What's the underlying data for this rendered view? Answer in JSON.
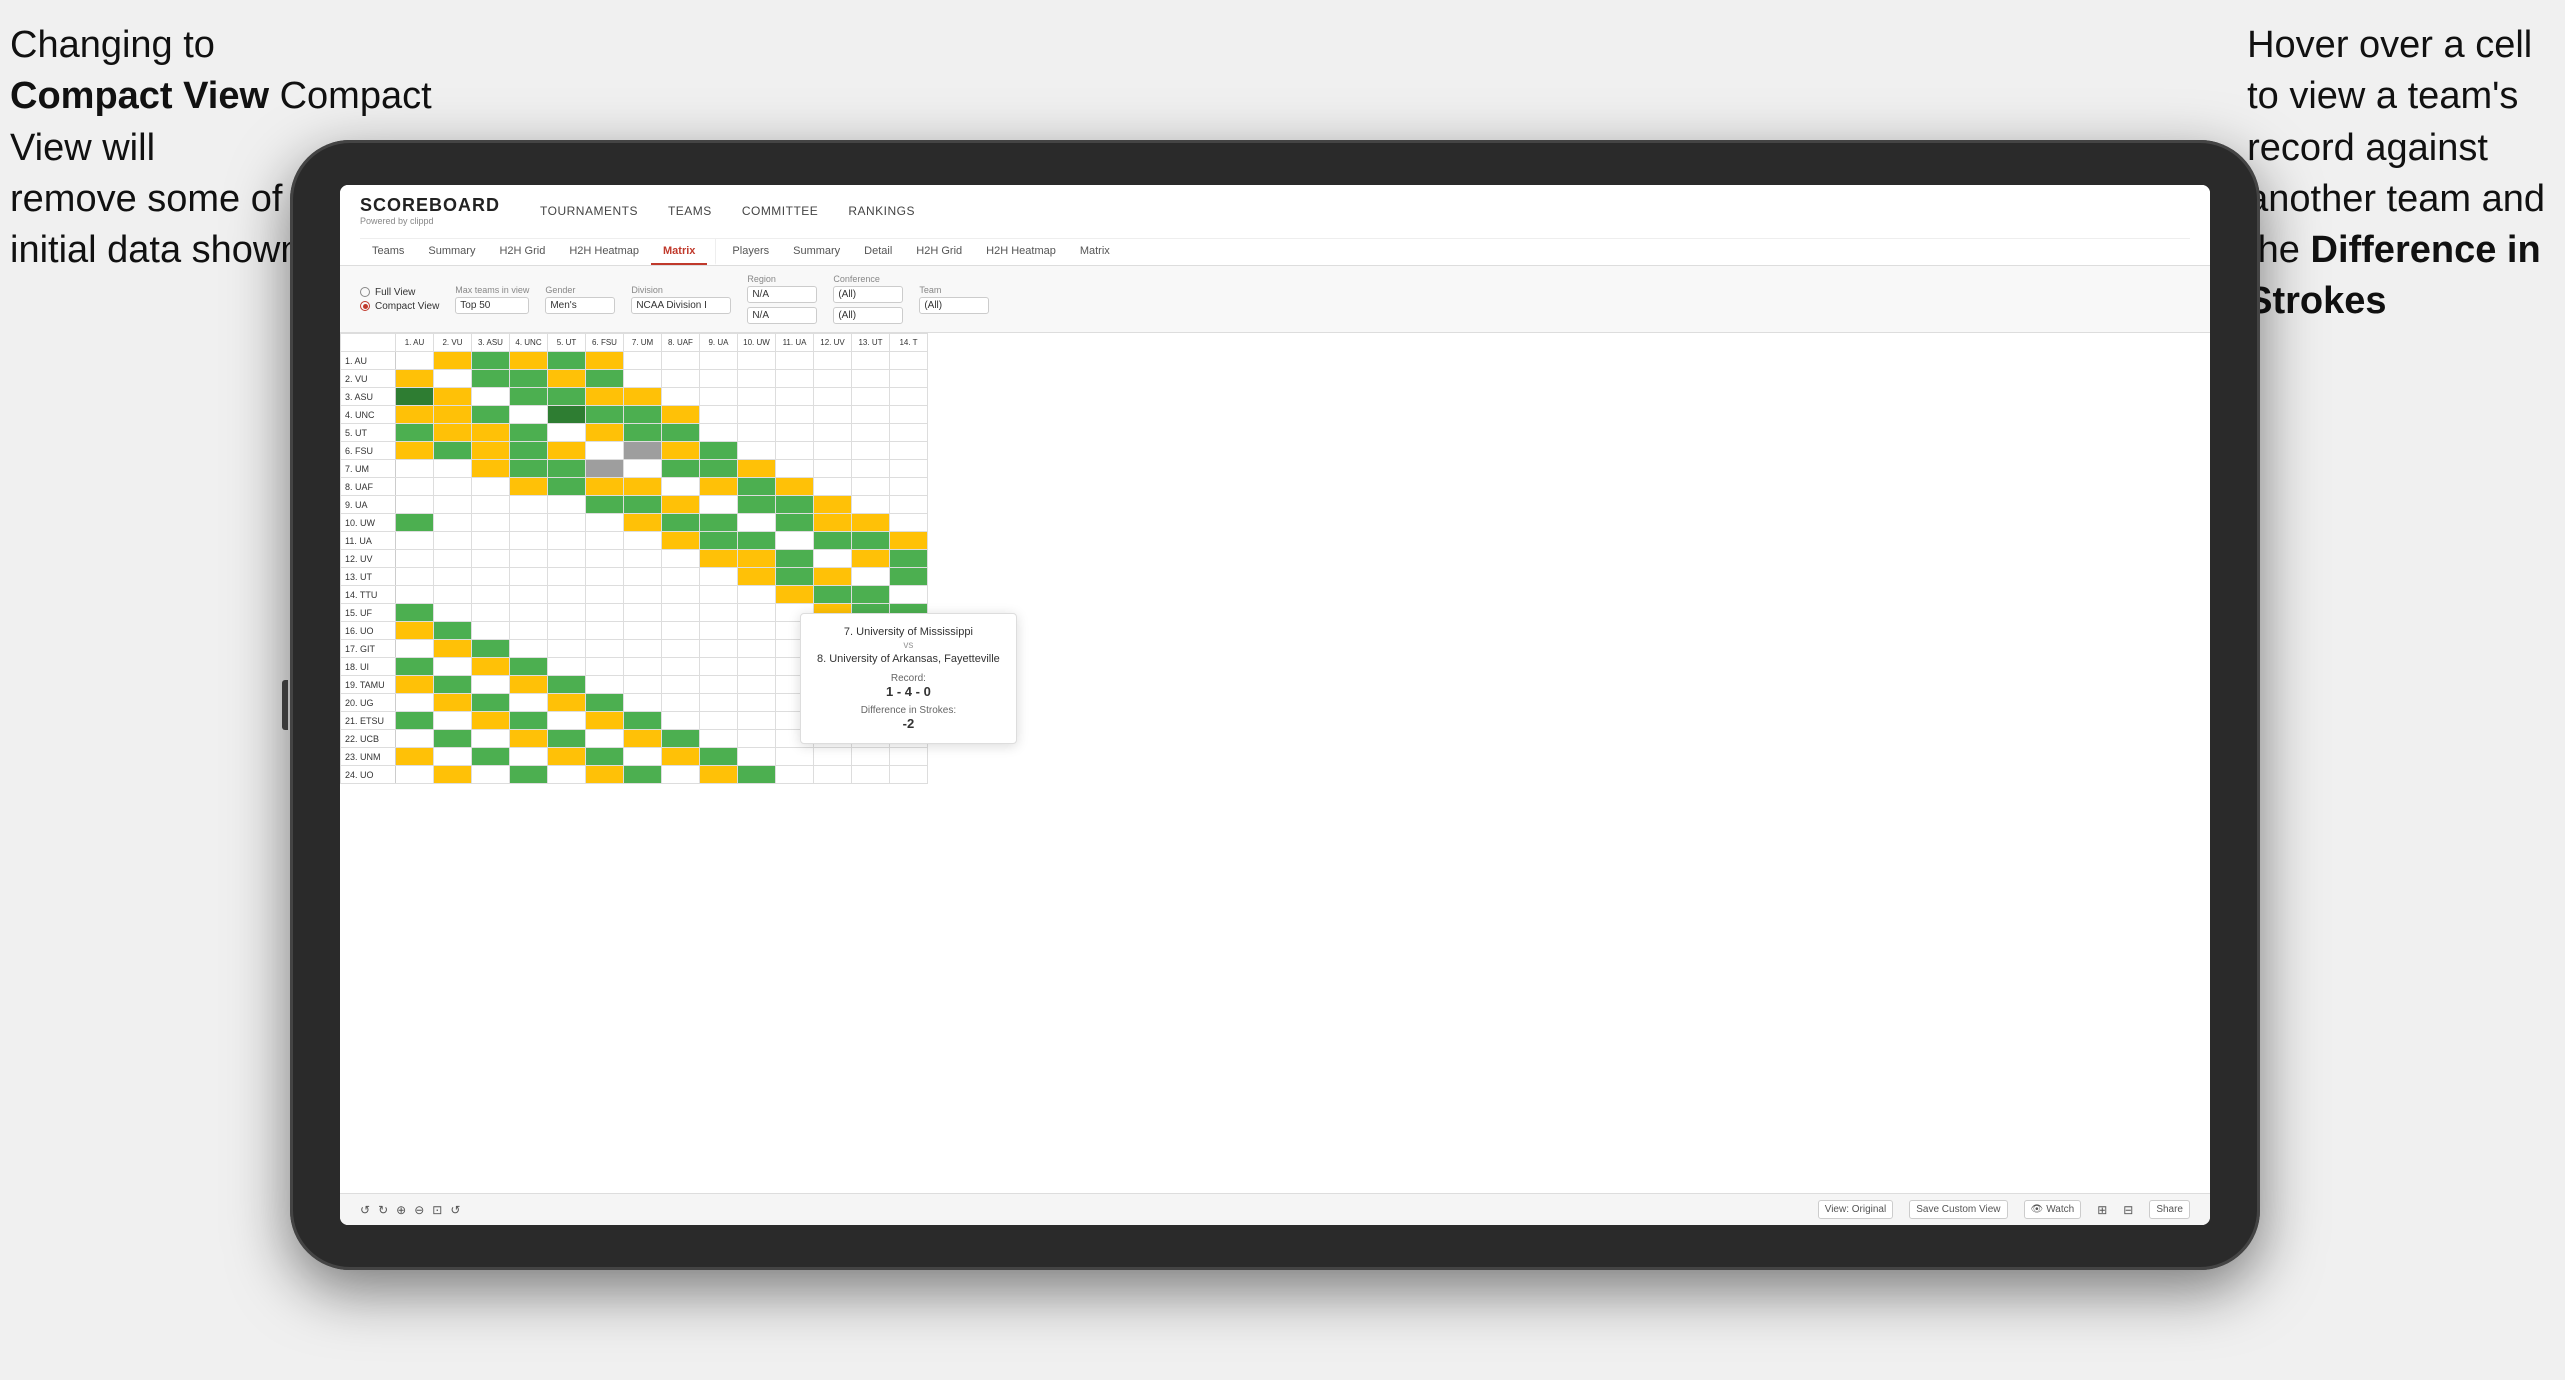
{
  "annotations": {
    "left": {
      "line1": "Changing to",
      "line2": "Compact View will",
      "line3": "remove some of the",
      "line4": "initial data shown"
    },
    "right": {
      "line1": "Hover over a cell",
      "line2": "to view a team's",
      "line3": "record against",
      "line4": "another team and",
      "line5": "the ",
      "line6": "Difference in",
      "line7": "Strokes"
    }
  },
  "navbar": {
    "logo": "SCOREBOARD",
    "logo_sub": "Powered by clippd",
    "nav_items": [
      "TOURNAMENTS",
      "TEAMS",
      "COMMITTEE",
      "RANKINGS"
    ]
  },
  "subnav": {
    "groups": [
      {
        "label": "Teams",
        "active": false
      },
      {
        "label": "Summary",
        "active": false
      },
      {
        "label": "H2H Grid",
        "active": false
      },
      {
        "label": "H2H Heatmap",
        "active": false
      },
      {
        "label": "Matrix",
        "active": true
      },
      {
        "label": "Players",
        "active": false
      },
      {
        "label": "Summary",
        "active": false
      },
      {
        "label": "Detail",
        "active": false
      },
      {
        "label": "H2H Grid",
        "active": false
      },
      {
        "label": "H2H Heatmap",
        "active": false
      },
      {
        "label": "Matrix",
        "active": false
      }
    ]
  },
  "filters": {
    "view_full": "Full View",
    "view_compact": "Compact View",
    "selected_view": "compact",
    "max_teams_label": "Max teams in view",
    "max_teams_value": "Top 50",
    "gender_label": "Gender",
    "gender_value": "Men's",
    "division_label": "Division",
    "division_value": "NCAA Division I",
    "region_label": "Region",
    "region_value": "N/A",
    "conference_label": "Conference",
    "conference_value": "(All)",
    "conference_value2": "(All)",
    "team_label": "Team",
    "team_value": "(All)"
  },
  "column_headers": [
    "1. AU",
    "2. VU",
    "3. ASU",
    "4. UNC",
    "5. UT",
    "6. FSU",
    "7. UM",
    "8. UAF",
    "9. UA",
    "10. UW",
    "11. UA",
    "12. UV",
    "13. UT",
    "14. T"
  ],
  "row_labels": [
    "1. AU",
    "2. VU",
    "3. ASU",
    "4. UNC",
    "5. UT",
    "6. FSU",
    "7. UM",
    "8. UAF",
    "9. UA",
    "10. UW",
    "11. UA",
    "12. UV",
    "13. UT",
    "14. TTU",
    "15. UF",
    "16. UO",
    "17. GIT",
    "18. UI",
    "19. TAMU",
    "20. UG",
    "21. ETSU",
    "22. UCB",
    "23. UNM",
    "24. UO"
  ],
  "tooltip": {
    "team1": "7. University of Mississippi",
    "vs": "vs",
    "team2": "8. University of Arkansas, Fayetteville",
    "record_label": "Record:",
    "record_value": "1 - 4 - 0",
    "strokes_label": "Difference in Strokes:",
    "strokes_value": "-2"
  },
  "toolbar": {
    "view_original": "View: Original",
    "save_custom": "Save Custom View",
    "watch": "Watch",
    "share": "Share"
  }
}
